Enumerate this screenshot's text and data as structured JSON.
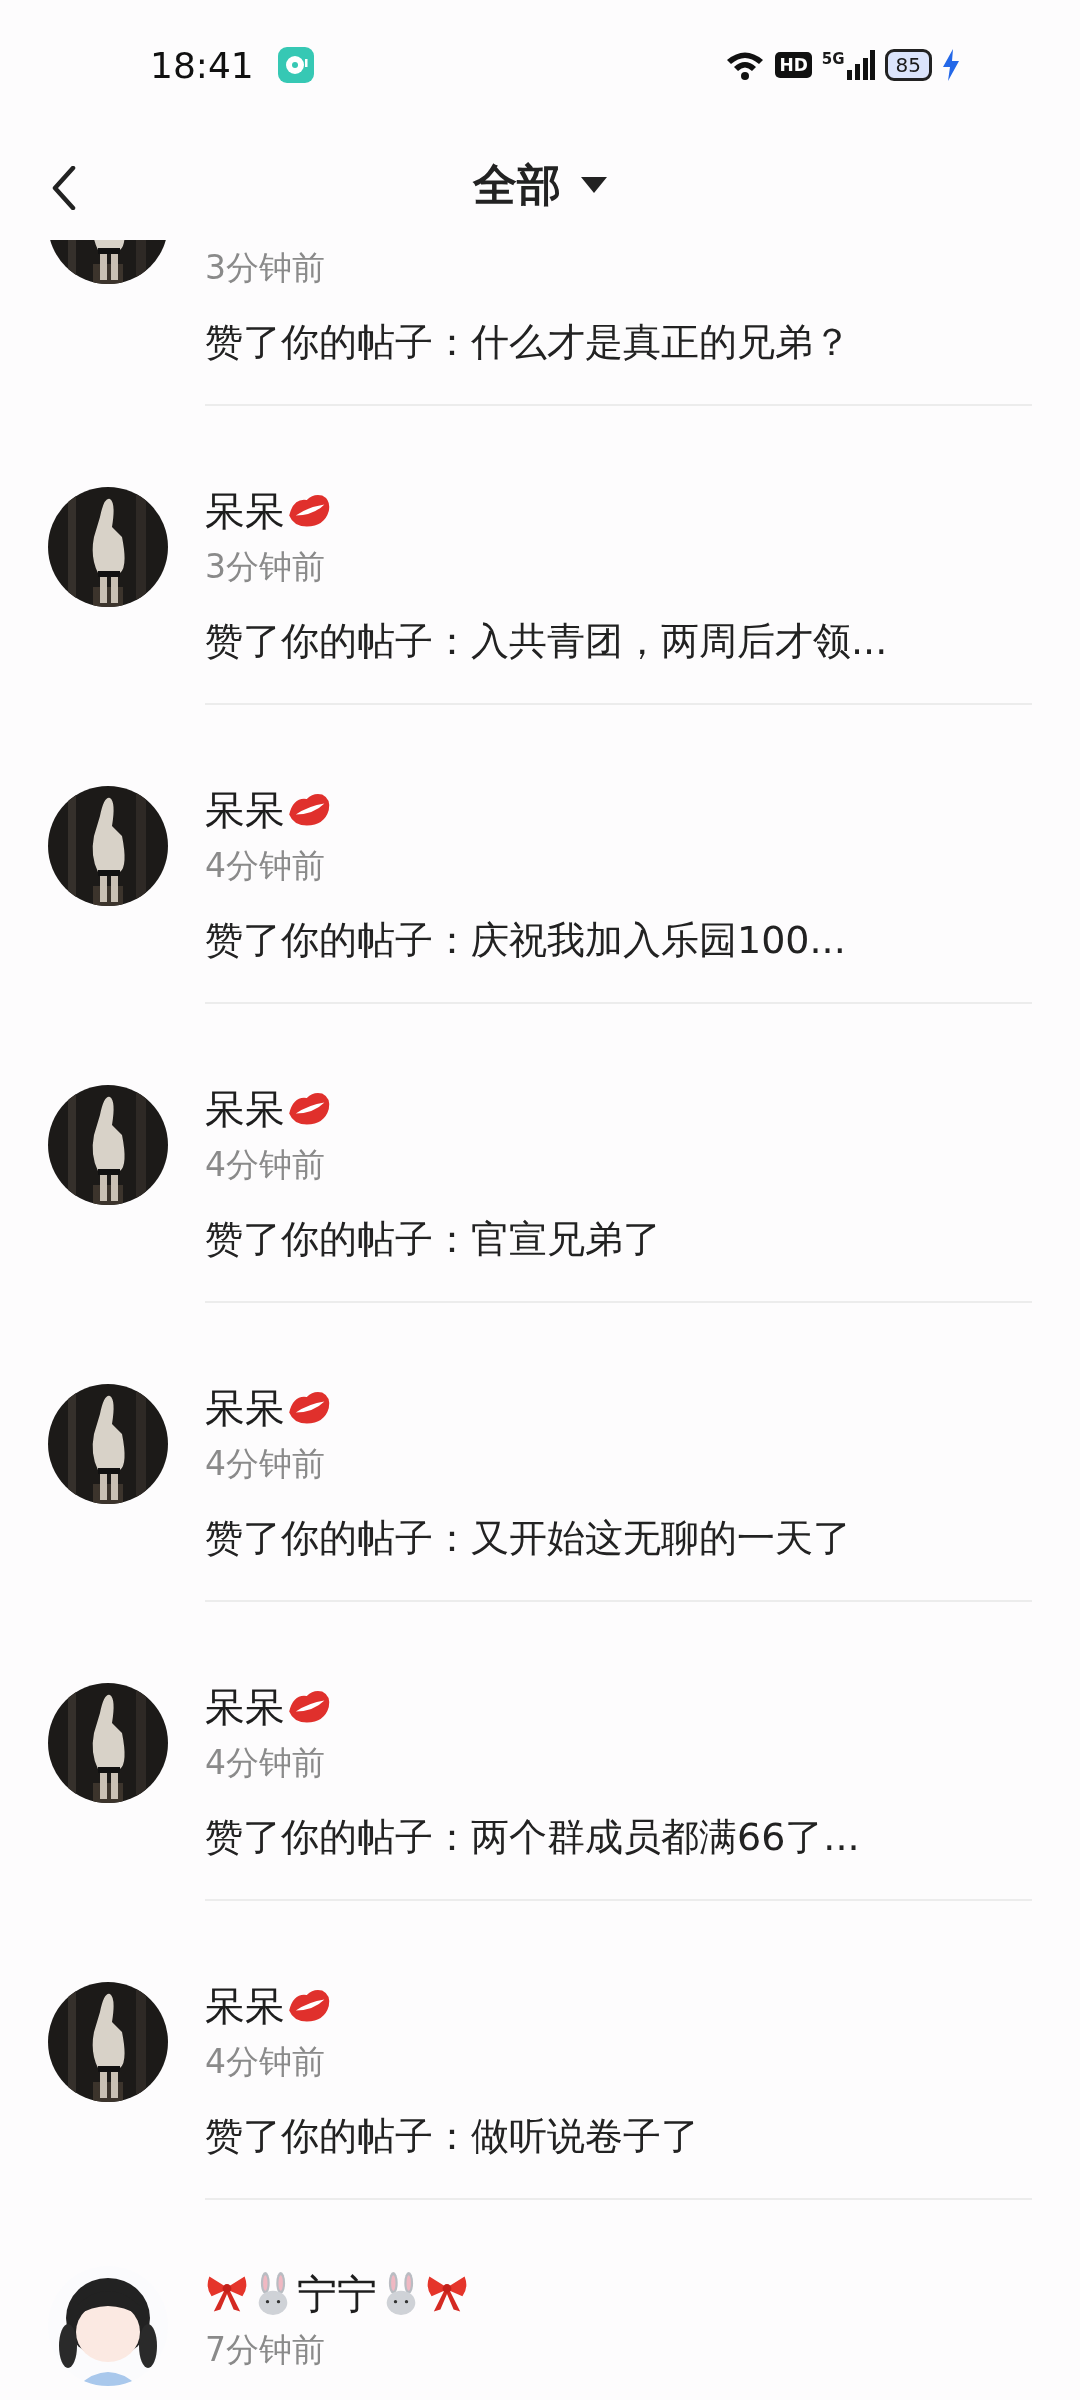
{
  "status_bar": {
    "time": "18:41",
    "network_badge": "HD",
    "network_type": "5G",
    "battery": "85"
  },
  "header": {
    "title": "全部"
  },
  "notifications": [
    {
      "kind": "cut-top",
      "decor": {
        "kind": "none"
      },
      "time": "3分钟前",
      "message": "赞了你的帖子：什么才是真正的兄弟？"
    },
    {
      "kind": "full",
      "name": "呆呆",
      "decor": {
        "kind": "lips"
      },
      "time": "3分钟前",
      "message": "赞了你的帖子：入共青团，两周后才领..."
    },
    {
      "kind": "full",
      "name": "呆呆",
      "decor": {
        "kind": "lips"
      },
      "time": "4分钟前",
      "message": "赞了你的帖子：庆祝我加入乐园100..."
    },
    {
      "kind": "full",
      "name": "呆呆",
      "decor": {
        "kind": "lips"
      },
      "time": "4分钟前",
      "message": "赞了你的帖子：官宣兄弟了"
    },
    {
      "kind": "full",
      "name": "呆呆",
      "decor": {
        "kind": "lips"
      },
      "time": "4分钟前",
      "message": "赞了你的帖子：又开始这无聊的一天了"
    },
    {
      "kind": "full",
      "name": "呆呆",
      "decor": {
        "kind": "lips"
      },
      "time": "4分钟前",
      "message": "赞了你的帖子：两个群成员都满66了..."
    },
    {
      "kind": "full",
      "name": "呆呆",
      "decor": {
        "kind": "lips"
      },
      "time": "4分钟前",
      "message": "赞了你的帖子：做听说卷子了"
    },
    {
      "kind": "cut-bottom",
      "name": "宁宁",
      "decor": {
        "kind": "bunny"
      },
      "time": "7分钟前"
    }
  ]
}
